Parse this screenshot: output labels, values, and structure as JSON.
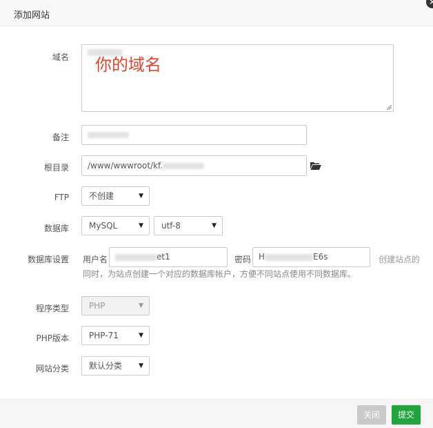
{
  "dialog": {
    "title": "添加网站"
  },
  "form": {
    "domain": {
      "label": "域名",
      "annotation": "你的域名"
    },
    "remark": {
      "label": "备注"
    },
    "root": {
      "label": "根目录",
      "value_prefix": "/www/wwwroot/kf."
    },
    "ftp": {
      "label": "FTP",
      "selected": "不创建"
    },
    "database": {
      "label": "数据库",
      "type_selected": "MySQL",
      "charset_selected": "utf-8"
    },
    "db_settings": {
      "label": "数据库设置",
      "username_label": "用户名",
      "username_suffix": "et1",
      "password_label": "密码",
      "password_prefix": "H",
      "password_suffix": "E6s",
      "hint_line1": "创建站点的",
      "hint_line2": "同时，为站点创建一个对应的数据库帐户，方便不同站点使用不同数据库。"
    },
    "program_type": {
      "label": "程序类型",
      "selected": "PHP"
    },
    "php_version": {
      "label": "PHP版本",
      "selected": "PHP-71"
    },
    "site_category": {
      "label": "网站分类",
      "selected": "默认分类"
    }
  },
  "footer": {
    "close_label": "关闭",
    "submit_label": "提交"
  },
  "colors": {
    "submit": "#20a53a",
    "annotation": "#e5452e"
  }
}
